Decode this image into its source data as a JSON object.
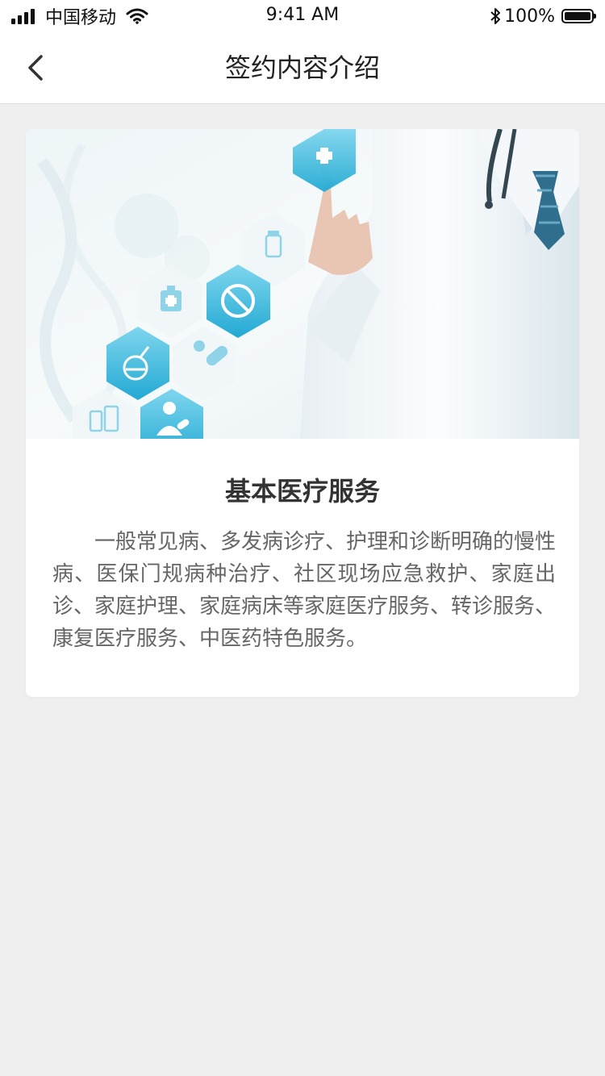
{
  "status_bar": {
    "signal_bars": 4,
    "carrier": "中国移动",
    "time": "9:41 AM",
    "battery_text": "100%",
    "battery_level": 1.0
  },
  "nav": {
    "title": "签约内容介绍",
    "back_icon": "chevron-left-icon"
  },
  "card": {
    "title": "基本医疗服务",
    "description": "一般常见病、多发病诊疗、护理和诊断明确的慢性病、医保门规病种治疗、社区现场应急救护、家庭出诊、家庭护理、家庭病床等家庭医疗服务、转诊服务、康复医疗服务、中医药特色服务。",
    "banner_icons": [
      "medical-cross-icon",
      "medicine-bottle-icon",
      "first-aid-kit-icon",
      "pill-icon",
      "flask-icon",
      "capsule-icon",
      "pharmacy-jars-icon",
      "doctor-icon"
    ]
  },
  "colors": {
    "background": "#efefef",
    "accent": "#2fb3d8",
    "text_primary": "#333333",
    "text_secondary": "#666666"
  }
}
